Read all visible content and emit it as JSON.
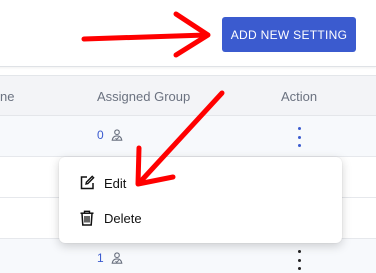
{
  "header": {
    "add_button_label": "ADD NEW SETTING"
  },
  "table": {
    "columns": [
      "ne",
      "Assigned Group",
      "Action"
    ],
    "rows": [
      {
        "group_count": "0"
      },
      {
        "group_count": ""
      },
      {
        "group_count": ""
      },
      {
        "group_count": "1"
      }
    ]
  },
  "row_menu": {
    "items": [
      {
        "label": "Edit",
        "icon": "edit-icon"
      },
      {
        "label": "Delete",
        "icon": "trash-icon"
      }
    ]
  },
  "colors": {
    "accent": "#3b5bcf",
    "arrow": "#ff0000",
    "header_bg": "#f3f4f7"
  }
}
